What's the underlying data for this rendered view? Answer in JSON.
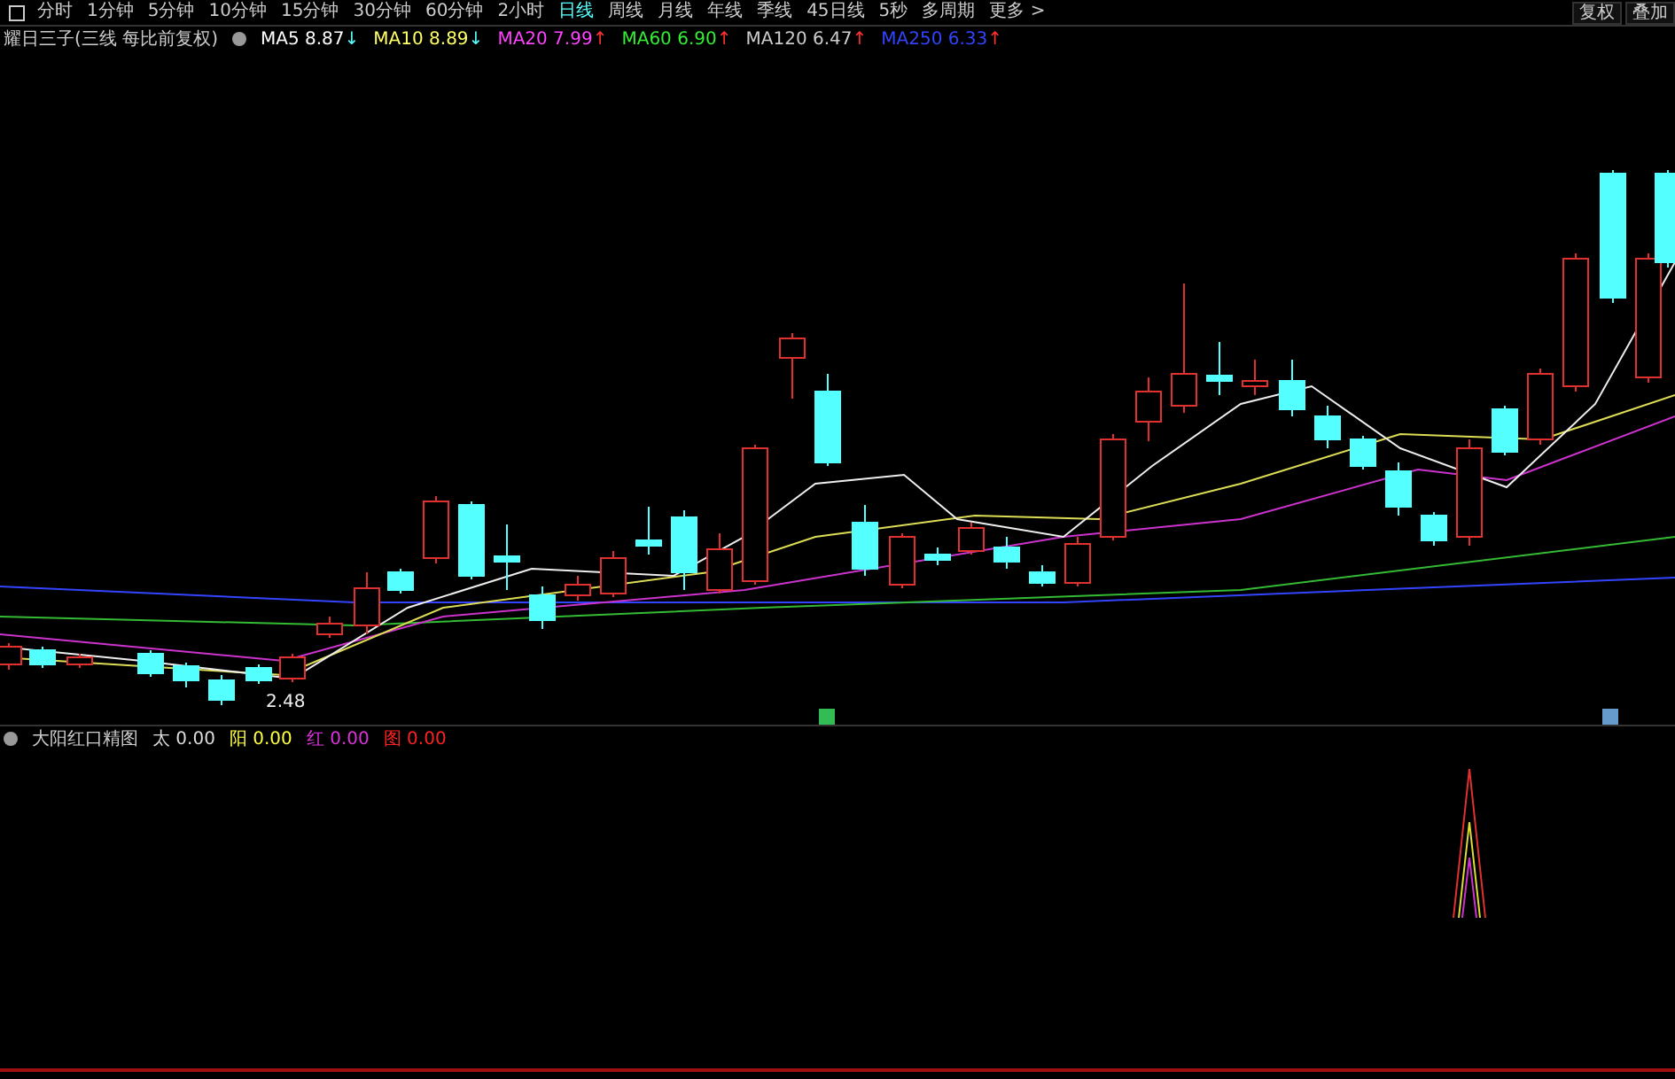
{
  "toolbar": {
    "tabs": [
      {
        "label": "分时",
        "selected": false
      },
      {
        "label": "1分钟",
        "selected": false
      },
      {
        "label": "5分钟",
        "selected": false
      },
      {
        "label": "10分钟",
        "selected": false
      },
      {
        "label": "15分钟",
        "selected": false
      },
      {
        "label": "30分钟",
        "selected": false
      },
      {
        "label": "60分钟",
        "selected": false
      },
      {
        "label": "2小时",
        "selected": false
      },
      {
        "label": "日线",
        "selected": true
      },
      {
        "label": "周线",
        "selected": false
      },
      {
        "label": "月线",
        "selected": false
      },
      {
        "label": "年线",
        "selected": false
      },
      {
        "label": "季线",
        "selected": false
      },
      {
        "label": "45日线",
        "selected": false
      },
      {
        "label": "5秒",
        "selected": false
      },
      {
        "label": "多周期",
        "selected": false
      },
      {
        "label": "更多 >",
        "selected": false
      }
    ],
    "right_buttons": [
      "复权",
      "叠加"
    ]
  },
  "main_chart": {
    "title": "耀日三子(三线 每比前复权)",
    "ma": [
      {
        "label": "MA5",
        "value": "8.87",
        "arrow": "↓",
        "color": "#ffffff"
      },
      {
        "label": "MA10",
        "value": "8.89",
        "arrow": "↓",
        "color": "#ffff66"
      },
      {
        "label": "MA20",
        "value": "7.99",
        "arrow": "↑",
        "color": "#ff44ff"
      },
      {
        "label": "MA60",
        "value": "6.90",
        "arrow": "↑",
        "color": "#33ee33"
      },
      {
        "label": "MA120",
        "value": "6.47",
        "arrow": "↑",
        "color": "#cccccc"
      },
      {
        "label": "MA250",
        "value": "6.33",
        "arrow": "↑",
        "color": "#3344ff"
      }
    ],
    "low_label": "2.48"
  },
  "indicator": {
    "title": "大阳红口精图",
    "values": [
      {
        "label": "太",
        "value": "0.00",
        "color": "#dddddd"
      },
      {
        "label": "阳",
        "value": "0.00",
        "color": "#ffff44"
      },
      {
        "label": "红",
        "value": "0.00",
        "color": "#dd33dd"
      },
      {
        "label": "图",
        "value": "0.00",
        "color": "#ff2222"
      }
    ]
  }
}
